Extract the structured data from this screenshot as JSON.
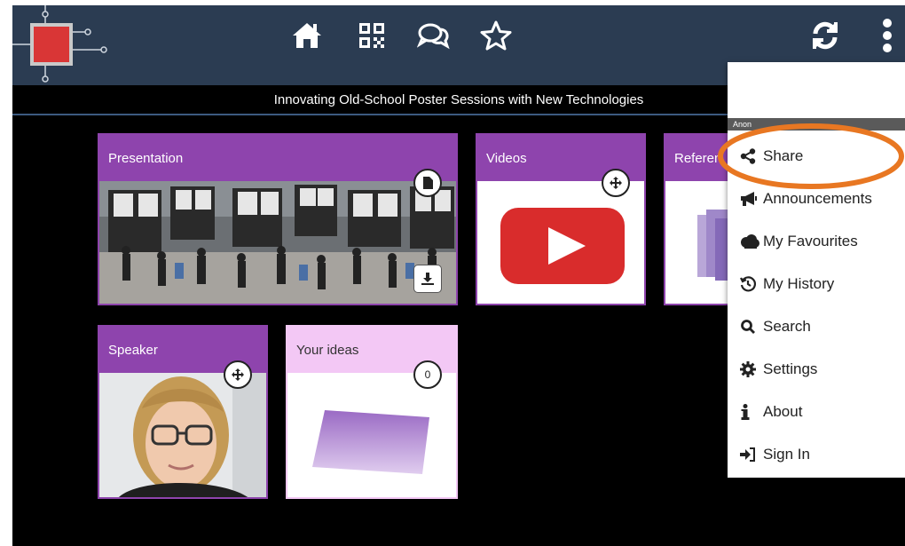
{
  "header": {
    "subtitle": "Innovating Old-School Poster Sessions with New Technologies",
    "nav_icons": [
      "home-icon",
      "qr-code-icon",
      "comments-icon",
      "star-icon"
    ],
    "right_icons": [
      "refresh-icon",
      "more-vertical-icon"
    ]
  },
  "tiles": {
    "presentation": {
      "label": "Presentation"
    },
    "videos": {
      "label": "Videos"
    },
    "references": {
      "label": "Referen"
    },
    "speaker": {
      "label": "Speaker"
    },
    "ideas": {
      "label": "Your ideas",
      "count": "0"
    }
  },
  "menu": {
    "strip_text": "Anon",
    "items": [
      {
        "label": "Share",
        "icon": "share-icon"
      },
      {
        "label": "Announcements",
        "icon": "bullhorn-icon"
      },
      {
        "label": "My Favourites",
        "icon": "cloud-icon"
      },
      {
        "label": "My History",
        "icon": "history-icon"
      },
      {
        "label": "Search",
        "icon": "search-icon"
      },
      {
        "label": "Settings",
        "icon": "gear-icon"
      },
      {
        "label": "About",
        "icon": "info-icon"
      },
      {
        "label": "Sign In",
        "icon": "sign-in-icon"
      }
    ]
  },
  "colors": {
    "topbar": "#2b3c52",
    "tile_purple": "#8e44ad",
    "tile_pink": "#f3c8f5",
    "highlight": "#e87722"
  }
}
